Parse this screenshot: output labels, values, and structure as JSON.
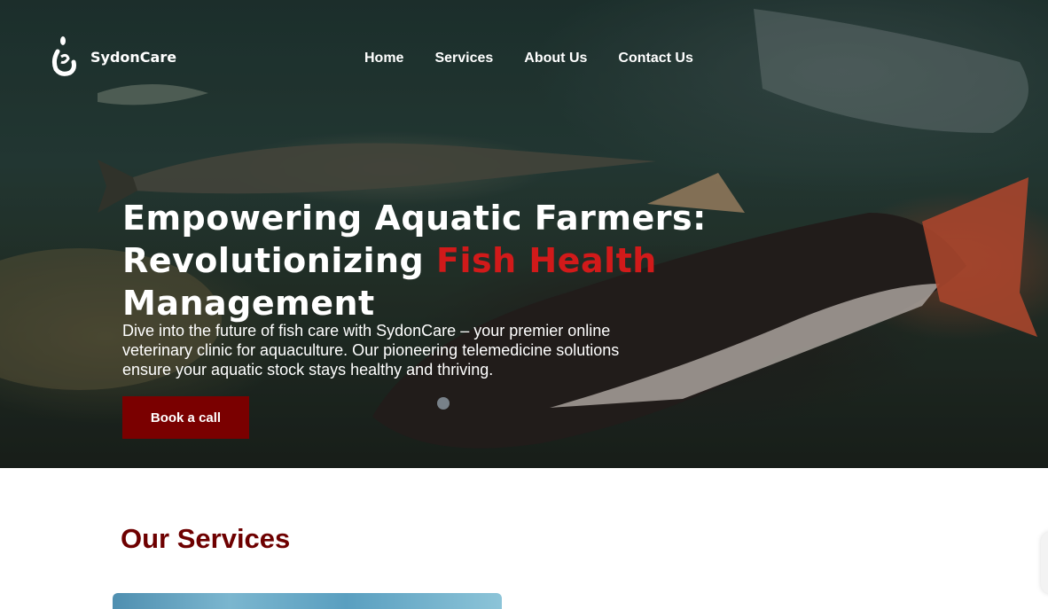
{
  "brand": {
    "name": "SydonCare",
    "logo_icon": "fish-hook-icon"
  },
  "nav": {
    "items": [
      {
        "label": "Home"
      },
      {
        "label": "Services"
      },
      {
        "label": "About Us"
      },
      {
        "label": "Contact Us"
      }
    ]
  },
  "hero": {
    "headline_part1": "Empowering Aquatic Farmers: Revolutionizing ",
    "headline_accent": "Fish Health",
    "headline_part2": " Management",
    "lead": "Dive into the future of fish care with SydonCare – your premier online veterinary clinic for aquaculture. Our pioneering telemedicine solutions ensure your aquatic stock stays healthy and thriving.",
    "cta_label": "Book a call"
  },
  "services": {
    "title": "Our Services"
  },
  "colors": {
    "accent_red": "#d11a1a",
    "button_bg": "#7a0000",
    "heading_dark_red": "#6e0000"
  }
}
